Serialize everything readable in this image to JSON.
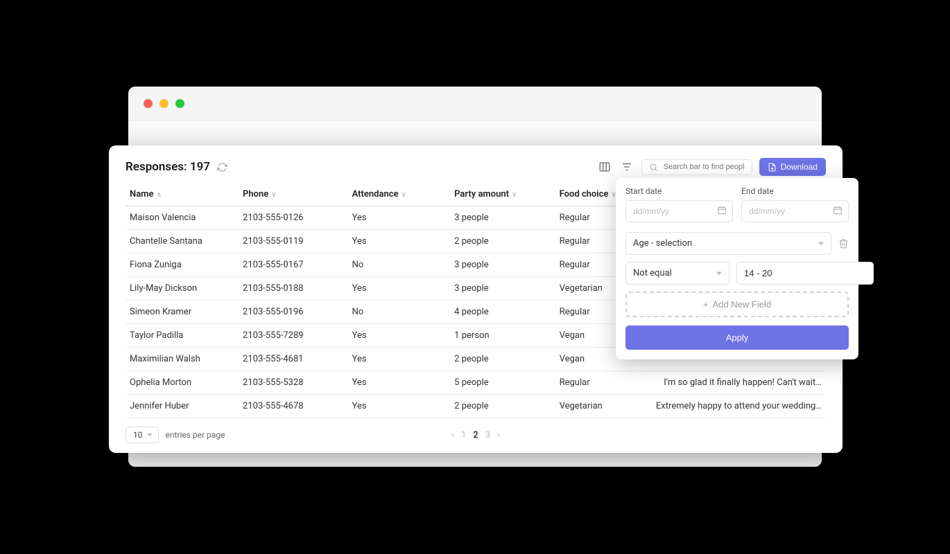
{
  "header": {
    "responses_label": "Responses:",
    "responses_count": "197",
    "search_placeholder": "Search bar to find people",
    "download_label": "Download"
  },
  "columns": {
    "name": "Name",
    "phone": "Phone",
    "attendance": "Attendance",
    "party": "Party amount",
    "food": "Food choice"
  },
  "rows": [
    {
      "name": "Maison Valencia",
      "phone": "2103-555-0126",
      "attendance": "Yes",
      "party": "3 people",
      "food": "Regular",
      "comment": ""
    },
    {
      "name": "Chantelle Santana",
      "phone": "2103-555-0119",
      "attendance": "Yes",
      "party": "2 people",
      "food": "Regular",
      "comment": ""
    },
    {
      "name": "Fiona Zuniga",
      "phone": "2103-555-0167",
      "attendance": "No",
      "party": "3 people",
      "food": "Regular",
      "comment": ""
    },
    {
      "name": "Lily-May Dickson",
      "phone": "2103-555-0188",
      "attendance": "Yes",
      "party": "3 people",
      "food": "Vegetarian",
      "comment": ""
    },
    {
      "name": "Simeon Kramer",
      "phone": "2103-555-0196",
      "attendance": "No",
      "party": "4 people",
      "food": "Regular",
      "comment": ""
    },
    {
      "name": "Taylor Padilla",
      "phone": "2103-555-7289",
      "attendance": "Yes",
      "party": "1 person",
      "food": "Vegan",
      "comment": ""
    },
    {
      "name": "Maximilian Walsh",
      "phone": "2103-555-4681",
      "attendance": "Yes",
      "party": "2 people",
      "food": "Vegan",
      "comment": ""
    },
    {
      "name": "Ophelia Morton",
      "phone": "2103-555-5328",
      "attendance": "Yes",
      "party": "5 people",
      "food": "Regular",
      "comment": "I'm so glad it finally happen! Can't wait…"
    },
    {
      "name": "Jennifer Huber",
      "phone": "2103-555-4678",
      "attendance": "Yes",
      "party": "2 people",
      "food": "Vegetarian",
      "comment": "Extremely happy to attend your wedding…"
    }
  ],
  "footer": {
    "per_page_value": "10",
    "per_page_label": "entries per page",
    "pages": [
      "1",
      "2",
      "3"
    ]
  },
  "filter": {
    "start_date_label": "Start date",
    "end_date_label": "End date",
    "date_placeholder": "dd/mm/yy",
    "field_select": "Age - selection",
    "operator": "Not equal",
    "value": "14 - 20",
    "add_field_label": "Add New Field",
    "apply_label": "Apply"
  }
}
